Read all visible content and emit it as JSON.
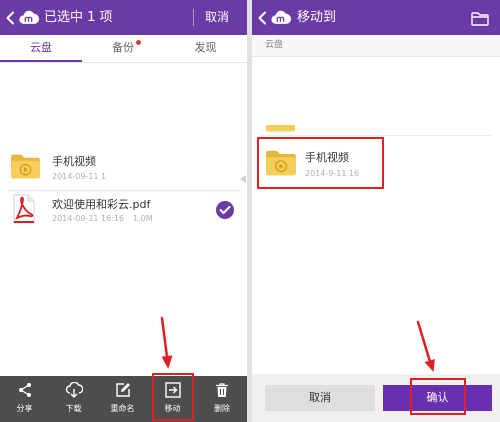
{
  "colors": {
    "brand_purple": "#6a3aa6",
    "toolbar_bg": "#4d4d4d",
    "annotation_red": "#e02020",
    "badge_red": "#e8382f",
    "folder_yellow": "#f5cf5a"
  },
  "left_screen": {
    "header": {
      "back_icon": "chevron-left-icon",
      "logo_icon": "cloud-logo-icon",
      "title": "已选中 1 项",
      "cancel_label": "取消"
    },
    "tabs": [
      {
        "label": "云盘",
        "active": true,
        "badge": false
      },
      {
        "label": "备份",
        "active": false,
        "badge": true
      },
      {
        "label": "发现",
        "active": false,
        "badge": false
      }
    ],
    "files": [
      {
        "icon": "video-folder-icon",
        "name": "手机视频",
        "date": "2014-09-11 1",
        "selected": false
      },
      {
        "icon": "pdf-file-icon",
        "name": "欢迎使用和彩云.pdf",
        "date": "2014-09-11 16:16",
        "size": "1.0M",
        "selected": true
      }
    ],
    "toolbar": [
      {
        "icon": "share-icon",
        "label": "分享",
        "highlighted": false
      },
      {
        "icon": "cloud-download-icon",
        "label": "下载",
        "highlighted": false
      },
      {
        "icon": "rename-icon",
        "label": "重命名",
        "highlighted": false
      },
      {
        "icon": "move-icon",
        "label": "移动",
        "highlighted": true
      },
      {
        "icon": "trash-icon",
        "label": "删除",
        "highlighted": false
      }
    ]
  },
  "right_screen": {
    "header": {
      "back_icon": "chevron-left-icon",
      "logo_icon": "cloud-logo-icon",
      "title": "移动到",
      "folder_icon": "folder-outline-icon"
    },
    "breadcrumb": "云盘",
    "folders": [
      {
        "icon": "video-folder-icon",
        "name": "手机视频",
        "date": "2014-9-11 16",
        "highlighted": true
      }
    ],
    "buttons": {
      "cancel_label": "取消",
      "confirm_label": "确认",
      "confirm_highlighted": true
    }
  }
}
